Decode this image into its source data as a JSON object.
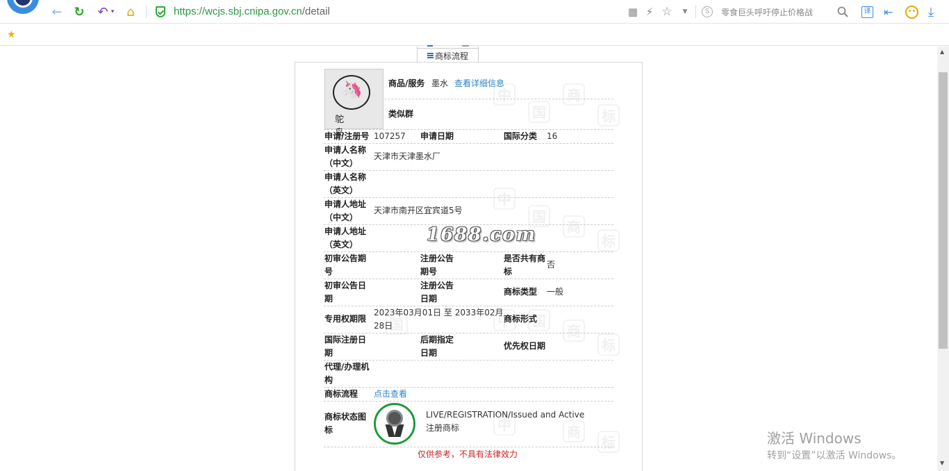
{
  "browser": {
    "url_host": "https://wcjs.sbj.cnipa.gov.cn",
    "url_path": "/detail",
    "search_placeholder": "零食巨头呼吁停止价格战",
    "icons": [
      "back-icon",
      "reload-icon",
      "undo-icon",
      "home-icon",
      "shield-icon",
      "qr-icon",
      "flash-icon",
      "star-icon",
      "search-engine-icon",
      "magnifier-icon",
      "translate-icon",
      "login-icon",
      "smile-icon",
      "download-icon"
    ]
  },
  "page": {
    "tab_flow_label": "商标流程",
    "trademark_image_text": "鸵 鸟",
    "goods_label": "商品/服务",
    "goods_value": "墨水",
    "goods_link": "查看详细信息",
    "similar_group_label": "类似群",
    "reg_no_label": "申请/注册号",
    "reg_no_value": "107257",
    "app_date_label": "申请日期",
    "intl_class_label": "国际分类",
    "intl_class_value": "16",
    "applicant_cn_label_1": "申请人名称",
    "applicant_cn_label_2": "（中文）",
    "applicant_cn_value": "天津市天津墨水厂",
    "applicant_en_label_1": "申请人名称",
    "applicant_en_label_2": "（英文）",
    "address_cn_label_1": "申请人地址",
    "address_cn_label_2": "（中文）",
    "address_cn_value": "天津市南开区宜宾道5号",
    "address_en_label_1": "申请人地址",
    "address_en_label_2": "（英文）",
    "prelim_issue_label_1": "初审公告期",
    "prelim_issue_label_2": "号",
    "reg_issue_label_1": "注册公告",
    "reg_issue_label_2": "期号",
    "shared_label_1": "是否共有商",
    "shared_label_2": "标",
    "shared_value": "否",
    "prelim_date_label_1": "初审公告日",
    "prelim_date_label_2": "期",
    "reg_date_label_1": "注册公告",
    "reg_date_label_2": "日期",
    "tm_type_label": "商标类型",
    "tm_type_value": "一般",
    "exclusive_label": "专用权期限",
    "exclusive_value_1": "2023年03月01日 至 2033年02月",
    "exclusive_value_2": "28日",
    "tm_form_label": "商标形式",
    "intl_reg_label_1": "国际注册日",
    "intl_reg_label_2": "期",
    "later_label_1": "后期指定",
    "later_label_2": "日期",
    "priority_label": "优先权日期",
    "agent_label_1": "代理/办理机",
    "agent_label_2": "构",
    "flow_label": "商标流程",
    "flow_link": "点击查看",
    "status_label_1": "商标状态图",
    "status_label_2": "标",
    "status_en": "LIVE/REGISTRATION/Issued and Active",
    "status_cn": "注册商标",
    "disclaimer": "仅供参考，不具有法律效力",
    "watermark_1688": "1688.com"
  },
  "windows": {
    "activate_title": "激活 Windows",
    "activate_sub": "转到“设置”以激活 Windows。"
  }
}
